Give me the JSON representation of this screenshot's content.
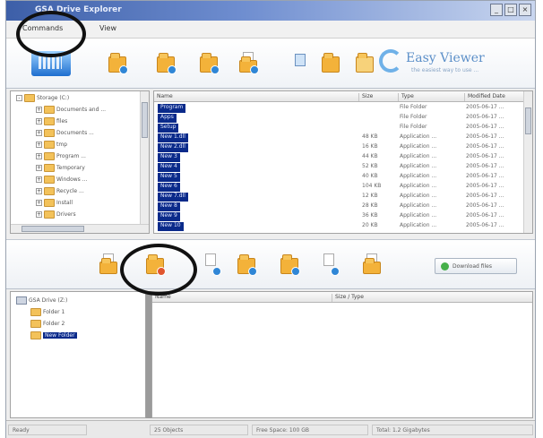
{
  "window": {
    "title": "GSA Drive Explorer"
  },
  "menu": {
    "items": [
      "Commands",
      "View"
    ]
  },
  "brand": {
    "name": "Easy Viewer",
    "tagline": "the easiest way to use ..."
  },
  "upper_tree": {
    "nodes": [
      {
        "label": "Storage (C:)",
        "depth": 0,
        "toggle": "-"
      },
      {
        "label": "Documents and ...",
        "depth": 1,
        "toggle": "+"
      },
      {
        "label": "files",
        "depth": 1,
        "toggle": "+"
      },
      {
        "label": "Documents ...",
        "depth": 1,
        "toggle": "+"
      },
      {
        "label": "tmp",
        "depth": 1,
        "toggle": "+"
      },
      {
        "label": "Program ...",
        "depth": 1,
        "toggle": "+"
      },
      {
        "label": "Temporary",
        "depth": 1,
        "toggle": "+"
      },
      {
        "label": "Windows ...",
        "depth": 1,
        "toggle": "+"
      },
      {
        "label": "Recycle ...",
        "depth": 1,
        "toggle": "+"
      },
      {
        "label": "Install",
        "depth": 1,
        "toggle": "+"
      },
      {
        "label": "Drivers",
        "depth": 1,
        "toggle": "+"
      }
    ]
  },
  "upper_list": {
    "columns": [
      "Name",
      "Size",
      "Type",
      "Modified Date"
    ],
    "rows": [
      {
        "name": "Program",
        "size": "",
        "type": "File Folder",
        "date": "2005-06-17 ..."
      },
      {
        "name": "Apps",
        "size": "",
        "type": "File Folder",
        "date": "2005-06-17 ..."
      },
      {
        "name": "Setup",
        "size": "",
        "type": "File Folder",
        "date": "2005-06-17 ..."
      },
      {
        "name": "New 1.dll",
        "size": "48 KB",
        "type": "Application ...",
        "date": "2005-06-17 ..."
      },
      {
        "name": "New 2.dll",
        "size": "16 KB",
        "type": "Application ...",
        "date": "2005-06-17 ..."
      },
      {
        "name": "New 3",
        "size": "44 KB",
        "type": "Application ...",
        "date": "2005-06-17 ..."
      },
      {
        "name": "New 4",
        "size": "52 KB",
        "type": "Application ...",
        "date": "2005-06-17 ..."
      },
      {
        "name": "New 5",
        "size": "40 KB",
        "type": "Application ...",
        "date": "2005-06-17 ..."
      },
      {
        "name": "New 6",
        "size": "104 KB",
        "type": "Application ...",
        "date": "2005-06-17 ..."
      },
      {
        "name": "New 7.dll",
        "size": "12 KB",
        "type": "Application ...",
        "date": "2005-06-17 ..."
      },
      {
        "name": "New 8",
        "size": "28 KB",
        "type": "Application ...",
        "date": "2005-06-17 ..."
      },
      {
        "name": "New 9",
        "size": "36 KB",
        "type": "Application ...",
        "date": "2005-06-17 ..."
      },
      {
        "name": "New 10",
        "size": "20 KB",
        "type": "Application ...",
        "date": "2005-06-17 ..."
      }
    ]
  },
  "middle_toolbar": {
    "button_label": "Download files"
  },
  "lower_tree": {
    "nodes": [
      {
        "label": "GSA Drive (Z:)",
        "depth": 0,
        "toggle": "-"
      },
      {
        "label": "Folder 1",
        "depth": 1,
        "toggle": ""
      },
      {
        "label": "Folder 2",
        "depth": 1,
        "toggle": ""
      },
      {
        "label": "New Folder",
        "depth": 1,
        "toggle": "",
        "selected": true
      }
    ]
  },
  "lower_list": {
    "columns": [
      "Name",
      "Size / Type"
    ]
  },
  "status": {
    "cells": [
      "Ready",
      "25 Objects",
      "Free Space: 100 GB",
      "Total: 1.2 Gigabytes"
    ]
  },
  "icons": {
    "toolbar1": [
      "back-folder-icon",
      "new-folder-icon",
      "copy-folder-icon",
      "upload-file-icon",
      "split-view-icon",
      "move-files-icon",
      "details-view-icon"
    ],
    "toolbar2": [
      "folder-up-icon",
      "upload-icon",
      "copy-icon",
      "new-folder-icon",
      "sync-icon",
      "download-icon",
      "delete-icon"
    ]
  },
  "colors": {
    "selection": "#0a2a8a",
    "folder": "#f3b23a",
    "title_gradient_start": "#3d5fa8"
  }
}
